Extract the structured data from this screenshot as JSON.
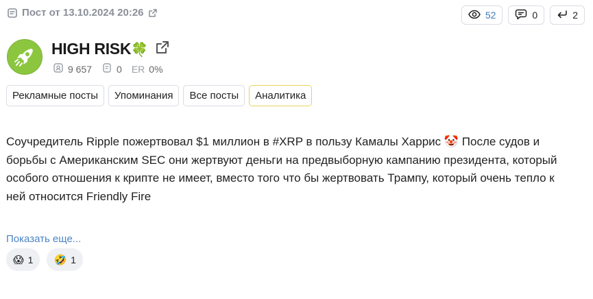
{
  "post": {
    "meta_label": "Пост от 13.10.2024 20:26"
  },
  "stats": {
    "views": "52",
    "comments": "0",
    "reposts": "2"
  },
  "channel": {
    "name": "HIGH RISK",
    "emoji": "🍀",
    "subscribers": "9 657",
    "mentions": "0",
    "er_label": "ER",
    "er_value": "0%"
  },
  "tabs": [
    {
      "label": "Рекламные посты"
    },
    {
      "label": "Упоминания"
    },
    {
      "label": "Все посты"
    },
    {
      "label": "Аналитика"
    }
  ],
  "content": {
    "text_part1": "Соучредитель Ripple пожертвовал $1 миллион в #XRP в пользу Камалы Харрис",
    "text_emoji": "🤡",
    "text_part2": " После судов и борьбы с Американским SEC они жертвуют деньги на предвыборную кампанию президента, который особого отношения к крипте не имеет, вместо того что бы жертвовать Трампу, который очень тепло к ней относится Friendly Fire",
    "show_more": "Показать еще..."
  },
  "reactions": [
    {
      "emoji": "😱",
      "count": "1"
    },
    {
      "emoji": "🤣",
      "count": "1"
    }
  ],
  "colors": {
    "accent_blue": "#3d7ab8",
    "active_tab_border": "#e9d35a",
    "avatar_green": "#8cc63f"
  }
}
